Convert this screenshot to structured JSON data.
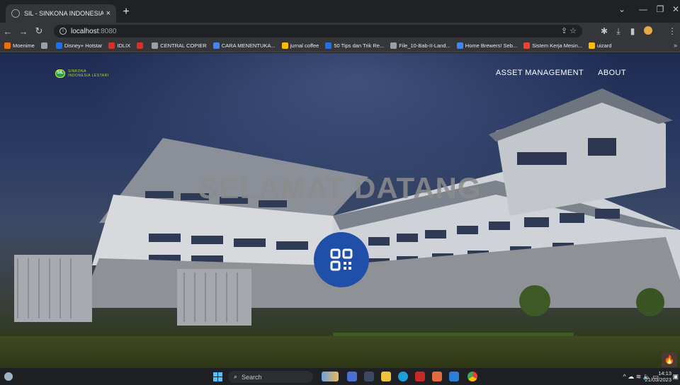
{
  "browser": {
    "tab_title": "SIL - SINKONA INDONESIA LESTARI",
    "new_tab": "+",
    "tab_close": "×",
    "url_host": "localhost",
    "url_port": ":8080",
    "bookmarks": [
      {
        "label": "Moenime",
        "color": "#e8710a"
      },
      {
        "label": "",
        "color": "#9aa0a6"
      },
      {
        "label": "Disney+ Hotstar",
        "color": "#1a73e8"
      },
      {
        "label": "IDLIX",
        "color": "#d93025"
      },
      {
        "label": "",
        "color": "#d93025"
      },
      {
        "label": "CENTRAL COPIER",
        "color": "#9aa0a6"
      },
      {
        "label": "CARA MENENTUKA...",
        "color": "#4285f4"
      },
      {
        "label": "jurnal coffee",
        "color": "#fbbc04"
      },
      {
        "label": "50 Tips dan Trik Re...",
        "color": "#1a73e8"
      },
      {
        "label": "File_10-Bab-II-Land...",
        "color": "#9aa0a6"
      },
      {
        "label": "Home Brewers! Seb...",
        "color": "#4285f4"
      },
      {
        "label": "Sistem Kerja Mesin...",
        "color": "#ea4335"
      },
      {
        "label": "uizard",
        "color": "#fbbc04"
      }
    ],
    "bookmarks_more": "»"
  },
  "site": {
    "logo_initials": "SIL",
    "logo_line1": "SINKONA",
    "logo_line2": "INDONESIA LESTARI",
    "nav": [
      "ASSET MANAGEMENT",
      "ABOUT"
    ],
    "hero_title": "SELAMAT DATANG",
    "accent_color": "#1f4fa8"
  },
  "taskbar": {
    "search_label": "Search",
    "time": "14:13",
    "date": "21/03/2023"
  }
}
